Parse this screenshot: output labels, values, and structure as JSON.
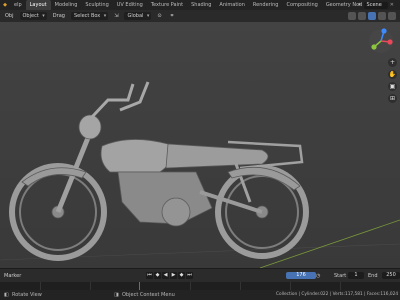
{
  "topbar": {
    "tabs": [
      "Layout",
      "Modeling",
      "Sculpting",
      "UV Editing",
      "Texture Paint",
      "Shading",
      "Animation",
      "Rendering",
      "Compositing",
      "Geometry Nod"
    ],
    "active_tab": "Layout",
    "first_menu": "elp",
    "scene_label": "Scene"
  },
  "header": {
    "mode": "Obj",
    "mode_value": "Object",
    "drag_label": "Drag",
    "select_tool": "Select Box",
    "orientation": "Global"
  },
  "timeline": {
    "marker_label": "Marker",
    "current_frame": "176",
    "start_label": "Start",
    "start_value": "1",
    "end_label": "End",
    "end_value": "250"
  },
  "status": {
    "rotate_view": "Rotate View",
    "context_menu": "Object Context Menu",
    "stats": "Collection | Cylinder.022 | Verts:117,581 | Faces:116,024"
  },
  "colors": {
    "active_blue": "#4772b3",
    "axis_x": "#e8485a",
    "axis_y": "#8cc63e",
    "axis_z": "#3d8bff"
  }
}
